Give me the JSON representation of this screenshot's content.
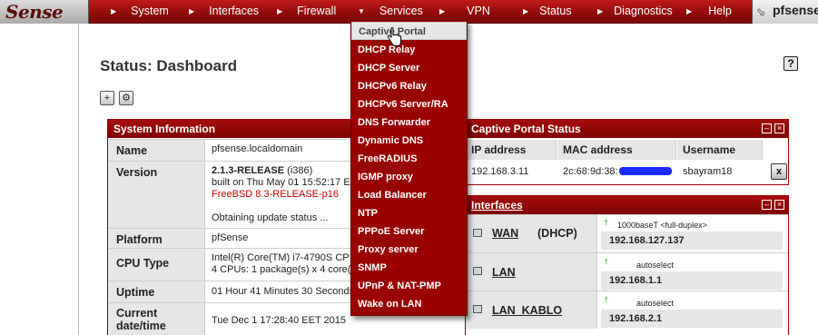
{
  "topbar": {
    "logo_text": "Sense",
    "nav": [
      "System",
      "Interfaces",
      "Firewall",
      "Services",
      "VPN",
      "Status",
      "Diagnostics",
      "Help"
    ],
    "hostname": "pfsense."
  },
  "page": {
    "title": "Status: Dashboard",
    "help_icon_text": "?",
    "add_widget_icon": "+",
    "settings_icon": "⚙"
  },
  "services_menu": {
    "items": [
      "Captive Portal",
      "DHCP Relay",
      "DHCP Server",
      "DHCPv6 Relay",
      "DHCPv6 Server/RA",
      "DNS Forwarder",
      "Dynamic DNS",
      "FreeRADIUS",
      "IGMP proxy",
      "Load Balancer",
      "NTP",
      "PPPoE Server",
      "Proxy server",
      "SNMP",
      "UPnP & NAT-PMP",
      "Wake on LAN"
    ],
    "hovered": "Captive Portal"
  },
  "system_info": {
    "header": "System Information",
    "rows": [
      {
        "label": "Name",
        "lines": [
          "pfsense.localdomain"
        ]
      },
      {
        "label": "Version",
        "release": "2.1.3-RELEASE",
        "arch": " (i386)",
        "lines": [
          "built on Thu May 01 15:52:17 E",
          "FreeBSD 8.3-RELEASE-p16",
          "",
          "Obtaining update status ..."
        ]
      },
      {
        "label": "Platform",
        "lines": [
          "pfSense"
        ]
      },
      {
        "label": "CPU Type",
        "lines": [
          "Intel(R) Core(TM) i7-4790S CP",
          "4 CPUs: 1 package(s) x 4 core(s"
        ]
      },
      {
        "label": "Uptime",
        "lines": [
          "01 Hour 41 Minutes 30 Seconds"
        ]
      },
      {
        "label": "Current date/time",
        "label_lines": [
          "Current",
          "date/time"
        ],
        "lines": [
          "Tue Dec 1 17:28:40 EET 2015"
        ]
      }
    ]
  },
  "captive_portal": {
    "header": "Captive Portal Status",
    "columns": [
      "IP address",
      "MAC address",
      "Username"
    ],
    "rows": [
      {
        "ip": "192.168.3.11",
        "mac": "2c:68:9d:38:",
        "username": "sbayram18"
      }
    ],
    "logout_icon": "x"
  },
  "interfaces": {
    "header": "Interfaces",
    "items": [
      {
        "name": "WAN",
        "mode": "(DHCP)",
        "status": "↑",
        "media": "1000baseT <full-duplex>",
        "ip": "192.168.127.137"
      },
      {
        "name": "LAN",
        "mode": "",
        "status": "↑",
        "media": "autoselect",
        "ip": "192.168.1.1"
      },
      {
        "name": "LAN_KABLO",
        "mode": "",
        "status": "↑",
        "media": "autoselect",
        "ip": "192.168.2.1"
      }
    ]
  },
  "widget_controls": {
    "minimize": "–",
    "close": "×"
  },
  "colors": {
    "accent": "#990000",
    "nav_bar": "#8e0b0b",
    "label_bg": "#e6e6e6",
    "status_up": "#0a9a0a"
  }
}
